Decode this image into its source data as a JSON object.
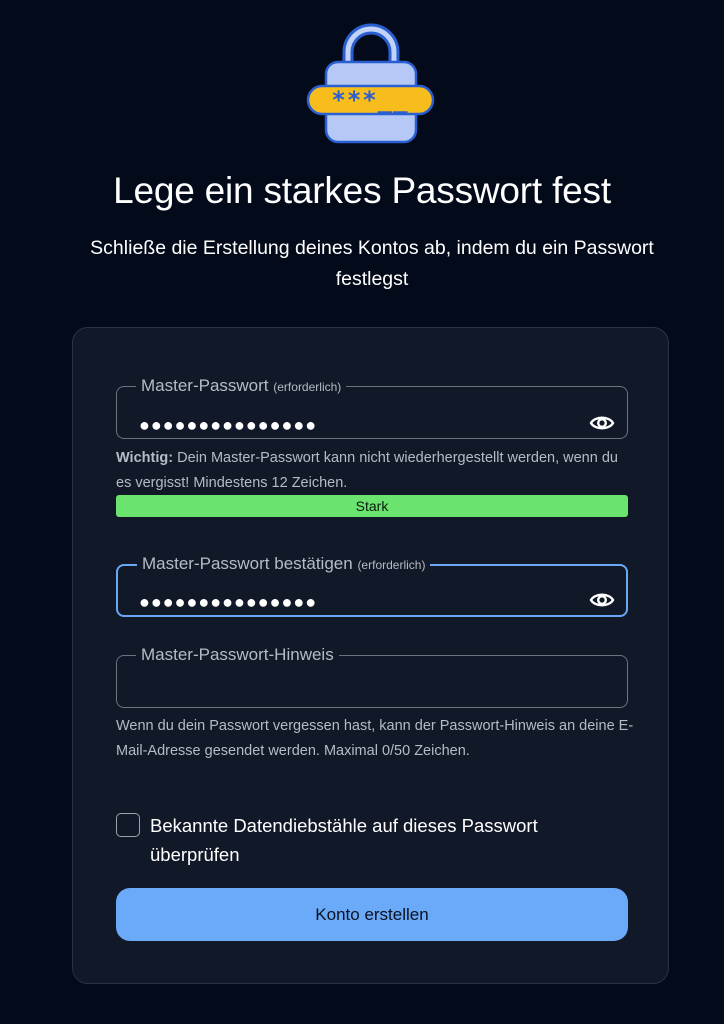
{
  "logo": {
    "icon": "padlock-password-icon",
    "text": "***__"
  },
  "title": "Lege ein starkes Passwort fest",
  "subtitle": "Schließe die Erstellung deines Kontos ab, indem du ein Passwort festlegst",
  "master_password": {
    "label": "Master-Passwort",
    "required": "(erforderlich)",
    "value_masked": "●●●●●●●●●●●●●●●",
    "toggle_icon": "eye-icon",
    "hint_bold": "Wichtig:",
    "hint": "Dein Master-Passwort kann nicht wiederhergestellt werden, wenn du es vergisst! Mindestens 12 Zeichen.",
    "strength_label": "Stark",
    "strength_color": "#6ae36f"
  },
  "confirm_password": {
    "label": "Master-Passwort bestätigen",
    "required": "(erforderlich)",
    "value_masked": "●●●●●●●●●●●●●●●",
    "toggle_icon": "eye-icon"
  },
  "password_hint": {
    "label": "Master-Passwort-Hinweis",
    "value": "",
    "helper": "Wenn du dein Passwort vergessen hast, kann der Passwort-Hinweis an deine E-Mail-Adresse gesendet werden. Maximal 0/50 Zeichen."
  },
  "breach_check": {
    "label": "Bekannte Datendiebstähle auf dieses Passwort überprüfen",
    "checked": false
  },
  "submit_label": "Konto erstellen",
  "colors": {
    "accent": "#6aaaf8",
    "focus_border": "#6aa8f7",
    "background": "#030a1a",
    "card": "#111827"
  }
}
